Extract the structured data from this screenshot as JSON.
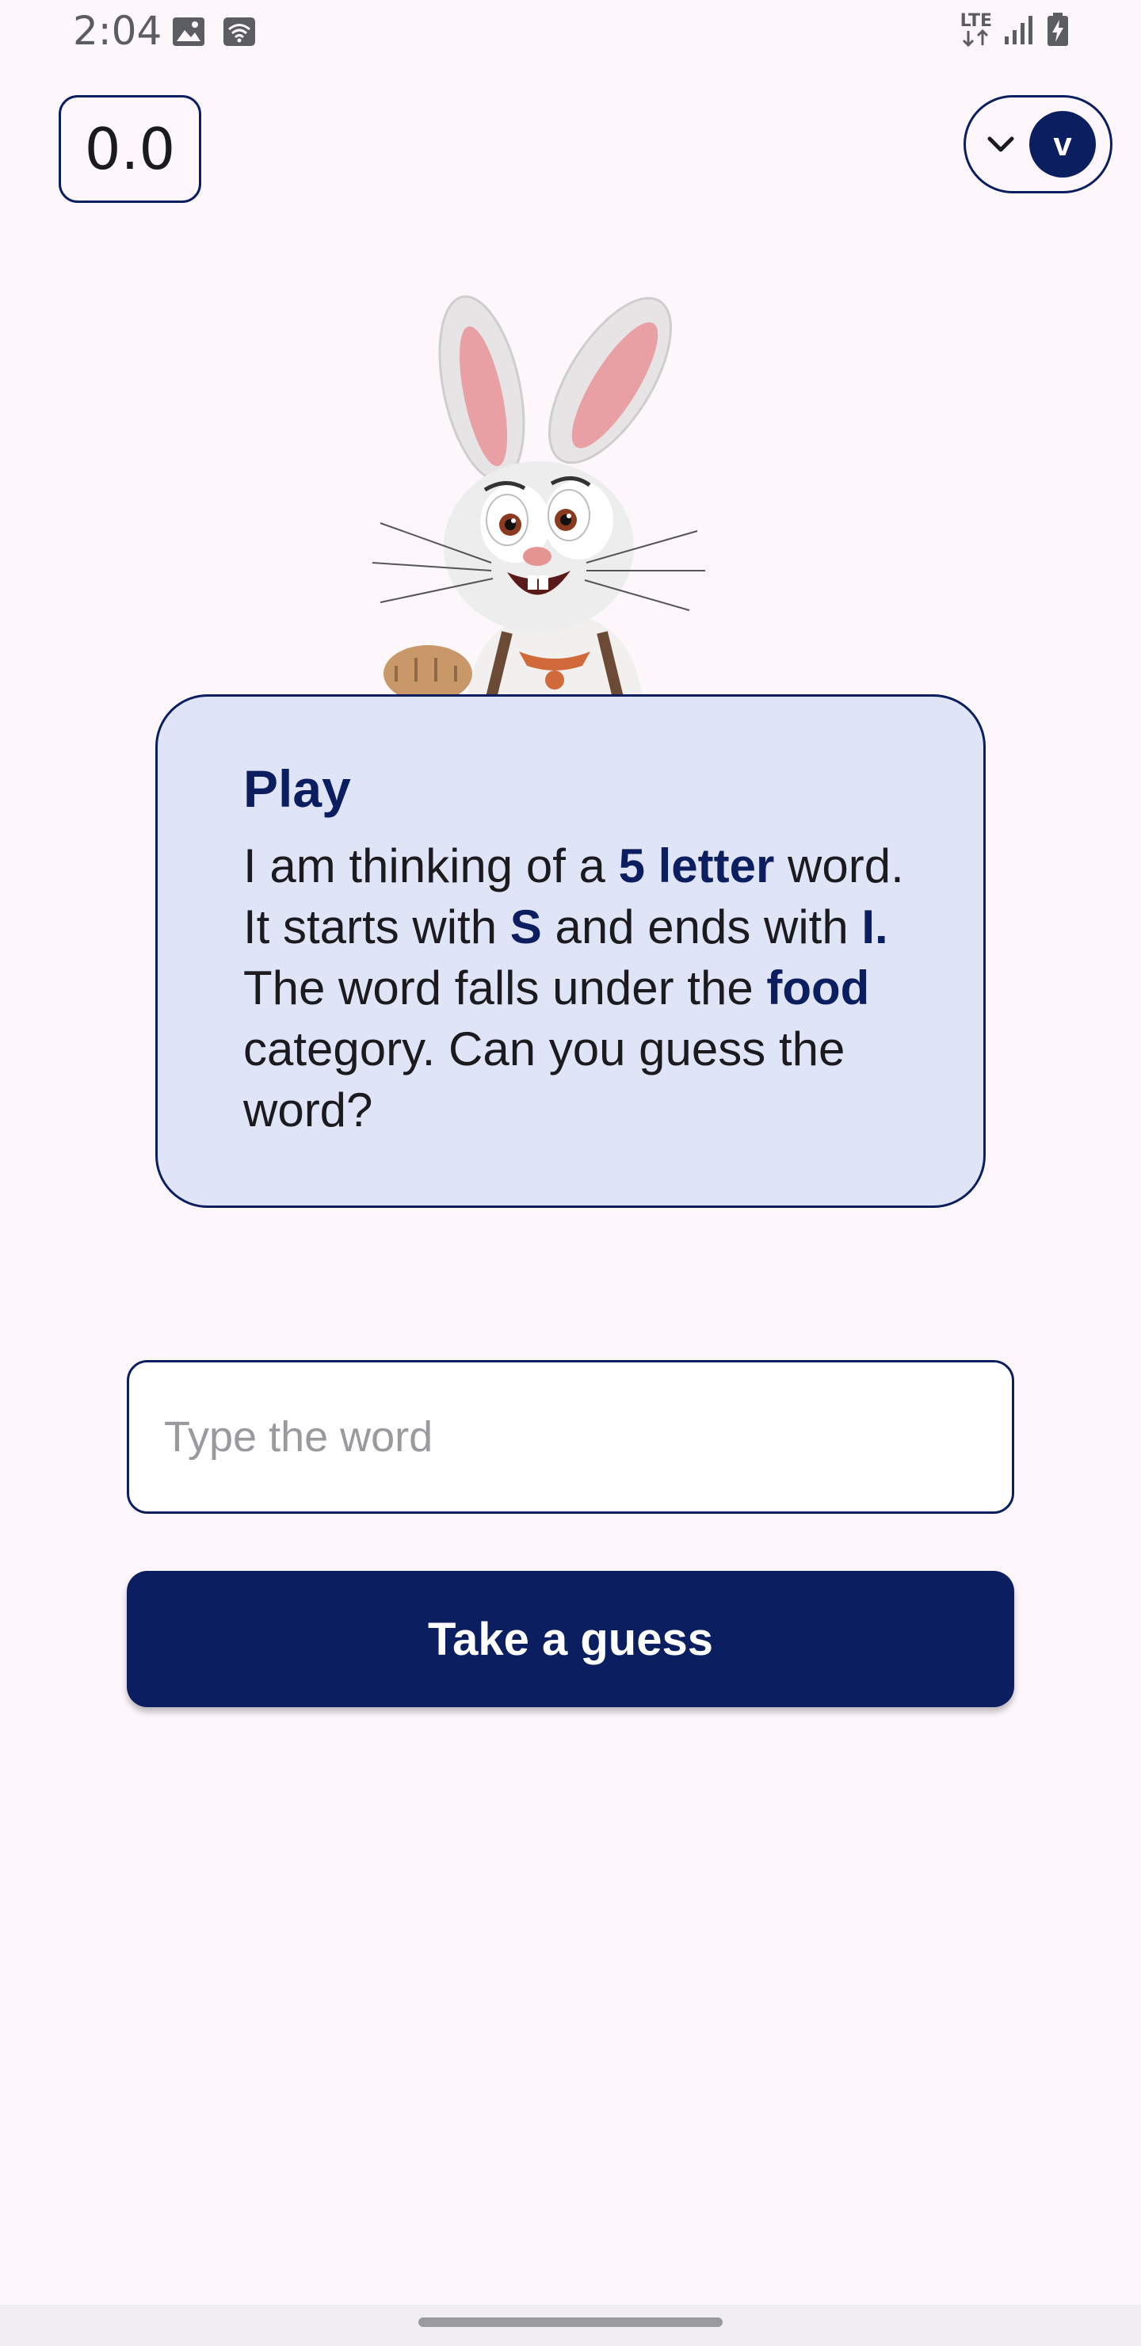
{
  "status_bar": {
    "time": "2:04",
    "network": "LTE",
    "icons": [
      "image-icon",
      "wifi-calling-icon",
      "lte-icon",
      "signal-icon",
      "battery-charging-icon"
    ]
  },
  "score": {
    "value": "0.0"
  },
  "account": {
    "avatar_letter": "v",
    "menu_icon": "chevron-down-icon"
  },
  "mascot": {
    "icon": "bunny-mascot"
  },
  "prompt_card": {
    "title": "Play",
    "segments": {
      "s1": "I am thinking of a ",
      "letter_count": "5 letter",
      "s2": " word. It starts with ",
      "start_letter": "S",
      "s3": " and ends with ",
      "end_letter": "I.",
      "s4": " The word falls under the ",
      "category": "food",
      "s5": " category. Can you guess the word?"
    }
  },
  "input": {
    "placeholder": "Type the word",
    "value": ""
  },
  "button": {
    "label": "Take a guess"
  },
  "colors": {
    "primary": "#0b1f60",
    "card_background": "#dfe4f7",
    "page_background": "#fdf7fc"
  }
}
